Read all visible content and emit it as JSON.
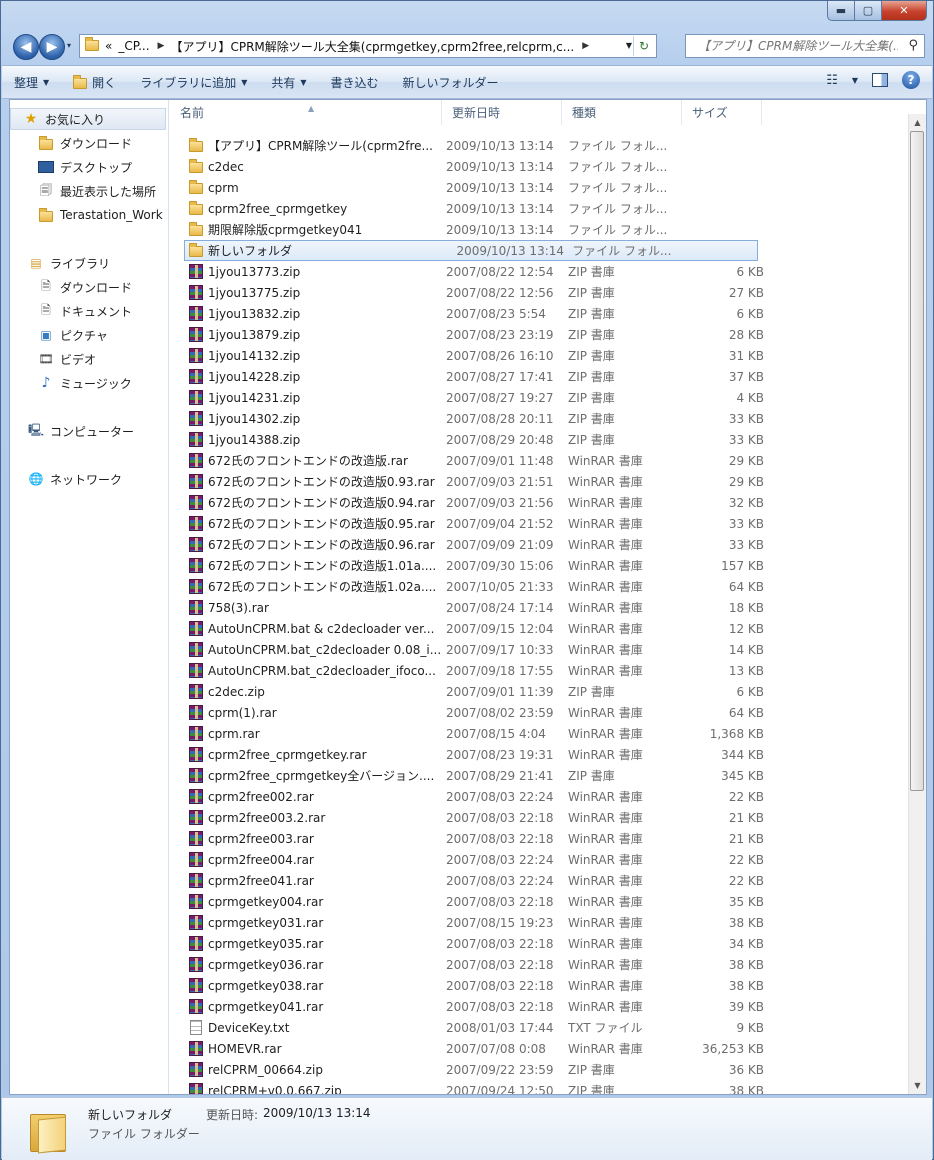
{
  "window": {
    "min_glyph": "▬",
    "max_glyph": "▢",
    "close_glyph": "✕"
  },
  "address": {
    "back_glyph": "◀",
    "forward_glyph": "▶",
    "history_glyph": "▾",
    "crumb_overflow": "«",
    "crumb1": "_CP...",
    "crumb2": "【アプリ】CPRM解除ツール大全集(cprmgetkey,cprm2free,relcprm,c...",
    "sep_glyph": "▶",
    "dropdown_glyph": "▼",
    "refresh_glyph": "↻"
  },
  "search": {
    "placeholder": "【アプリ】CPRM解除ツール大全集(...",
    "icon_glyph": "⚲"
  },
  "toolbar": {
    "organize": "整理",
    "open": "開く",
    "add_to_library": "ライブラリに追加",
    "share": "共有",
    "burn": "書き込む",
    "new_folder": "新しいフォルダー",
    "dropdown_glyph": "▼",
    "view_glyph": "☷",
    "help_glyph": "?"
  },
  "nav": {
    "favorites": "お気に入り",
    "downloads": "ダウンロード",
    "desktop": "デスクトップ",
    "recent": "最近表示した場所",
    "terastation": "Terastation_Work",
    "libraries": "ライブラリ",
    "lib_downloads": "ダウンロード",
    "documents": "ドキュメント",
    "pictures": "ピクチャ",
    "videos": "ビデオ",
    "music": "ミュージック",
    "computer": "コンピューター",
    "network": "ネットワーク",
    "icons": {
      "favorites": "★",
      "recent": "🗐",
      "library": "▤",
      "documents": "🗎",
      "pictures": "▣",
      "videos": "🎞",
      "music": "♪",
      "computer": "🖳",
      "network": "🌐"
    }
  },
  "columns": {
    "name": "名前",
    "date": "更新日時",
    "type": "種類",
    "size": "サイズ",
    "sort_glyph": "▲"
  },
  "files": [
    {
      "name": "【アプリ】CPRM解除ツール(cprm2fre...",
      "date": "2009/10/13 13:14",
      "type": "ファイル フォル...",
      "size": "",
      "icon": "folder-icon"
    },
    {
      "name": "c2dec",
      "date": "2009/10/13 13:14",
      "type": "ファイル フォル...",
      "size": "",
      "icon": "folder-icon"
    },
    {
      "name": "cprm",
      "date": "2009/10/13 13:14",
      "type": "ファイル フォル...",
      "size": "",
      "icon": "folder-icon"
    },
    {
      "name": "cprm2free_cprmgetkey",
      "date": "2009/10/13 13:14",
      "type": "ファイル フォル...",
      "size": "",
      "icon": "folder-icon"
    },
    {
      "name": "期限解除版cprmgetkey041",
      "date": "2009/10/13 13:14",
      "type": "ファイル フォル...",
      "size": "",
      "icon": "folder-icon"
    },
    {
      "name": "新しいフォルダ",
      "date": "2009/10/13 13:14",
      "type": "ファイル フォル...",
      "size": "",
      "icon": "folder-icon",
      "selected": true
    },
    {
      "name": "1jyou13773.zip",
      "date": "2007/08/22 12:54",
      "type": "ZIP 書庫",
      "size": "6 KB",
      "icon": "archive-icon"
    },
    {
      "name": "1jyou13775.zip",
      "date": "2007/08/22 12:56",
      "type": "ZIP 書庫",
      "size": "27 KB",
      "icon": "archive-icon"
    },
    {
      "name": "1jyou13832.zip",
      "date": "2007/08/23 5:54",
      "type": "ZIP 書庫",
      "size": "6 KB",
      "icon": "archive-icon"
    },
    {
      "name": "1jyou13879.zip",
      "date": "2007/08/23 23:19",
      "type": "ZIP 書庫",
      "size": "28 KB",
      "icon": "archive-icon"
    },
    {
      "name": "1jyou14132.zip",
      "date": "2007/08/26 16:10",
      "type": "ZIP 書庫",
      "size": "31 KB",
      "icon": "archive-icon"
    },
    {
      "name": "1jyou14228.zip",
      "date": "2007/08/27 17:41",
      "type": "ZIP 書庫",
      "size": "37 KB",
      "icon": "archive-icon"
    },
    {
      "name": "1jyou14231.zip",
      "date": "2007/08/27 19:27",
      "type": "ZIP 書庫",
      "size": "4 KB",
      "icon": "archive-icon"
    },
    {
      "name": "1jyou14302.zip",
      "date": "2007/08/28 20:11",
      "type": "ZIP 書庫",
      "size": "33 KB",
      "icon": "archive-icon"
    },
    {
      "name": "1jyou14388.zip",
      "date": "2007/08/29 20:48",
      "type": "ZIP 書庫",
      "size": "33 KB",
      "icon": "archive-icon"
    },
    {
      "name": "672氏のフロントエンドの改造版.rar",
      "date": "2007/09/01 11:48",
      "type": "WinRAR 書庫",
      "size": "29 KB",
      "icon": "archive-icon"
    },
    {
      "name": "672氏のフロントエンドの改造版0.93.rar",
      "date": "2007/09/03 21:51",
      "type": "WinRAR 書庫",
      "size": "29 KB",
      "icon": "archive-icon"
    },
    {
      "name": "672氏のフロントエンドの改造版0.94.rar",
      "date": "2007/09/03 21:56",
      "type": "WinRAR 書庫",
      "size": "32 KB",
      "icon": "archive-icon"
    },
    {
      "name": "672氏のフロントエンドの改造版0.95.rar",
      "date": "2007/09/04 21:52",
      "type": "WinRAR 書庫",
      "size": "33 KB",
      "icon": "archive-icon"
    },
    {
      "name": "672氏のフロントエンドの改造版0.96.rar",
      "date": "2007/09/09 21:09",
      "type": "WinRAR 書庫",
      "size": "33 KB",
      "icon": "archive-icon"
    },
    {
      "name": "672氏のフロントエンドの改造版1.01a....",
      "date": "2007/09/30 15:06",
      "type": "WinRAR 書庫",
      "size": "157 KB",
      "icon": "archive-icon"
    },
    {
      "name": "672氏のフロントエンドの改造版1.02a....",
      "date": "2007/10/05 21:33",
      "type": "WinRAR 書庫",
      "size": "64 KB",
      "icon": "archive-icon"
    },
    {
      "name": "758(3).rar",
      "date": "2007/08/24 17:14",
      "type": "WinRAR 書庫",
      "size": "18 KB",
      "icon": "archive-icon"
    },
    {
      "name": "AutoUnCPRM.bat & c2decloader ver...",
      "date": "2007/09/15 12:04",
      "type": "WinRAR 書庫",
      "size": "12 KB",
      "icon": "archive-icon"
    },
    {
      "name": "AutoUnCPRM.bat_c2decloader 0.08_i...",
      "date": "2007/09/17 10:33",
      "type": "WinRAR 書庫",
      "size": "14 KB",
      "icon": "archive-icon"
    },
    {
      "name": "AutoUnCPRM.bat_c2decloader_ifoco...",
      "date": "2007/09/18 17:55",
      "type": "WinRAR 書庫",
      "size": "13 KB",
      "icon": "archive-icon"
    },
    {
      "name": "c2dec.zip",
      "date": "2007/09/01 11:39",
      "type": "ZIP 書庫",
      "size": "6 KB",
      "icon": "archive-icon"
    },
    {
      "name": "cprm(1).rar",
      "date": "2007/08/02 23:59",
      "type": "WinRAR 書庫",
      "size": "64 KB",
      "icon": "archive-icon"
    },
    {
      "name": "cprm.rar",
      "date": "2007/08/15 4:04",
      "type": "WinRAR 書庫",
      "size": "1,368 KB",
      "icon": "archive-icon"
    },
    {
      "name": "cprm2free_cprmgetkey.rar",
      "date": "2007/08/23 19:31",
      "type": "WinRAR 書庫",
      "size": "344 KB",
      "icon": "archive-icon"
    },
    {
      "name": "cprm2free_cprmgetkey全バージョン....",
      "date": "2007/08/29 21:41",
      "type": "ZIP 書庫",
      "size": "345 KB",
      "icon": "archive-icon"
    },
    {
      "name": "cprm2free002.rar",
      "date": "2007/08/03 22:24",
      "type": "WinRAR 書庫",
      "size": "22 KB",
      "icon": "archive-icon"
    },
    {
      "name": "cprm2free003.2.rar",
      "date": "2007/08/03 22:18",
      "type": "WinRAR 書庫",
      "size": "21 KB",
      "icon": "archive-icon"
    },
    {
      "name": "cprm2free003.rar",
      "date": "2007/08/03 22:18",
      "type": "WinRAR 書庫",
      "size": "21 KB",
      "icon": "archive-icon"
    },
    {
      "name": "cprm2free004.rar",
      "date": "2007/08/03 22:24",
      "type": "WinRAR 書庫",
      "size": "22 KB",
      "icon": "archive-icon"
    },
    {
      "name": "cprm2free041.rar",
      "date": "2007/08/03 22:24",
      "type": "WinRAR 書庫",
      "size": "22 KB",
      "icon": "archive-icon"
    },
    {
      "name": "cprmgetkey004.rar",
      "date": "2007/08/03 22:18",
      "type": "WinRAR 書庫",
      "size": "35 KB",
      "icon": "archive-icon"
    },
    {
      "name": "cprmgetkey031.rar",
      "date": "2007/08/15 19:23",
      "type": "WinRAR 書庫",
      "size": "38 KB",
      "icon": "archive-icon"
    },
    {
      "name": "cprmgetkey035.rar",
      "date": "2007/08/03 22:18",
      "type": "WinRAR 書庫",
      "size": "34 KB",
      "icon": "archive-icon"
    },
    {
      "name": "cprmgetkey036.rar",
      "date": "2007/08/03 22:18",
      "type": "WinRAR 書庫",
      "size": "38 KB",
      "icon": "archive-icon"
    },
    {
      "name": "cprmgetkey038.rar",
      "date": "2007/08/03 22:18",
      "type": "WinRAR 書庫",
      "size": "38 KB",
      "icon": "archive-icon"
    },
    {
      "name": "cprmgetkey041.rar",
      "date": "2007/08/03 22:18",
      "type": "WinRAR 書庫",
      "size": "39 KB",
      "icon": "archive-icon"
    },
    {
      "name": "DeviceKey.txt",
      "date": "2008/01/03 17:44",
      "type": "TXT ファイル",
      "size": "9 KB",
      "icon": "txt-icon"
    },
    {
      "name": "HOMEVR.rar",
      "date": "2007/07/08 0:08",
      "type": "WinRAR 書庫",
      "size": "36,253 KB",
      "icon": "archive-icon"
    },
    {
      "name": "relCPRM_00664.zip",
      "date": "2007/09/22 23:59",
      "type": "ZIP 書庫",
      "size": "36 KB",
      "icon": "archive-icon"
    },
    {
      "name": "relCPRM+v0.0.667.zip",
      "date": "2007/09/24 12:50",
      "type": "ZIP 書庫",
      "size": "38 KB",
      "icon": "archive-icon"
    }
  ],
  "scrollbar": {
    "up_glyph": "▲",
    "down_glyph": "▼"
  },
  "details": {
    "name": "新しいフォルダ",
    "date_label": "更新日時:",
    "date": "2009/10/13 13:14",
    "type": "ファイル フォルダー"
  }
}
